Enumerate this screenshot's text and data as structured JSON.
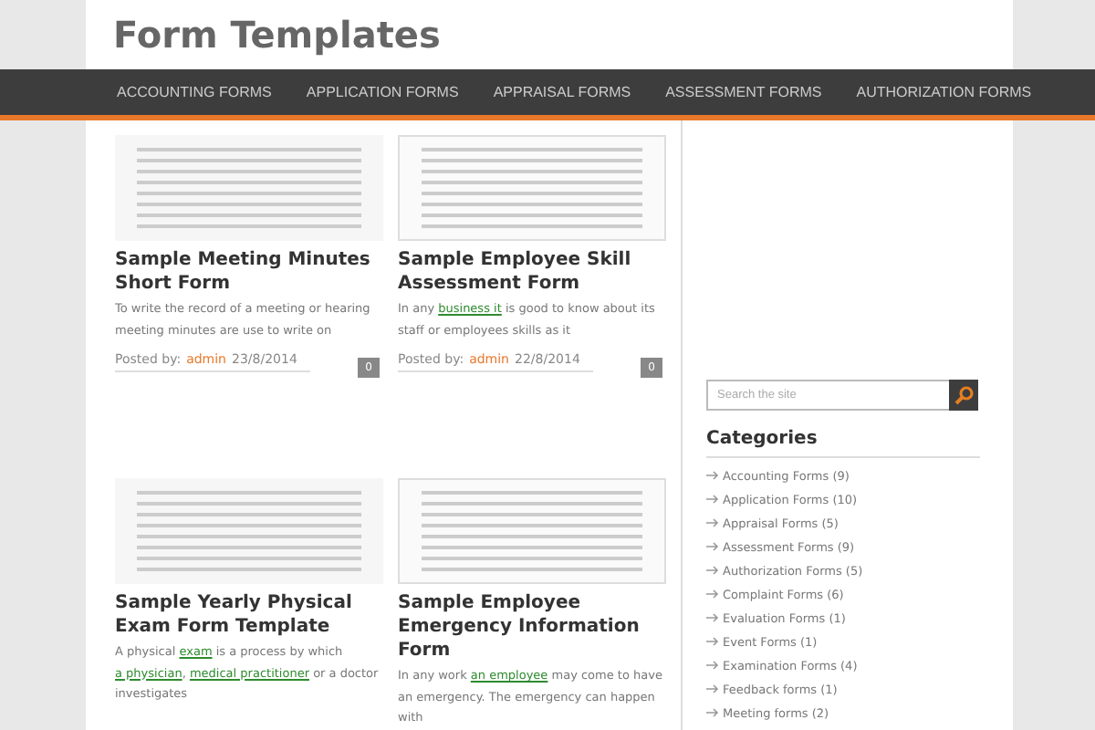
{
  "site": {
    "title": "Form Templates"
  },
  "nav": [
    {
      "label": "ACCOUNTING FORMS"
    },
    {
      "label": "APPLICATION FORMS"
    },
    {
      "label": "APPRAISAL FORMS"
    },
    {
      "label": "ASSESSMENT FORMS"
    },
    {
      "label": "AUTHORIZATION FORMS"
    }
  ],
  "posts": [
    {
      "title": "Sample Meeting Minutes Short Form",
      "excerpt": [
        {
          "kind": "text",
          "text": "To write the record of a meeting or hearing meeting minutes are use to write on"
        }
      ],
      "meta_label": "Posted by:",
      "author": "admin",
      "date": "23/8/2014",
      "comments": "0"
    },
    {
      "title": "Sample Employee Skill Assessment Form",
      "excerpt": [
        {
          "kind": "text",
          "text": "In any "
        },
        {
          "kind": "link",
          "text": "business it"
        },
        {
          "kind": "text",
          "text": " is good to know about its staff or employees skills as it"
        }
      ],
      "meta_label": "Posted by:",
      "author": "admin",
      "date": "22/8/2014",
      "comments": "0"
    },
    {
      "title": "Sample Yearly Physical Exam Form Template",
      "excerpt": [
        {
          "kind": "text",
          "text": "A physical "
        },
        {
          "kind": "link",
          "text": "exam"
        },
        {
          "kind": "text",
          "text": " is a process by which "
        },
        {
          "kind": "link",
          "text": "a physician"
        },
        {
          "kind": "text",
          "text": ", "
        },
        {
          "kind": "link",
          "text": "medical practitioner"
        },
        {
          "kind": "text",
          "text": " or a doctor investigates"
        }
      ]
    },
    {
      "title": "Sample Employee Emergency Information Form",
      "excerpt": [
        {
          "kind": "text",
          "text": "In any work "
        },
        {
          "kind": "link",
          "text": "an employee"
        },
        {
          "kind": "text",
          "text": " may come to have an emergency. The emergency can happen with"
        }
      ]
    }
  ],
  "sidebar": {
    "search": {
      "placeholder": "Search the site"
    },
    "heading": "Categories",
    "categories": [
      {
        "label": "Accounting Forms (9)"
      },
      {
        "label": "Application Forms (10)"
      },
      {
        "label": "Appraisal Forms (5)"
      },
      {
        "label": "Assessment Forms (9)"
      },
      {
        "label": "Authorization Forms (5)"
      },
      {
        "label": "Complaint Forms (6)"
      },
      {
        "label": "Evaluation Forms (1)"
      },
      {
        "label": "Event Forms (1)"
      },
      {
        "label": "Examination Forms (4)"
      },
      {
        "label": "Feedback forms (1)"
      },
      {
        "label": "Meeting forms (2)"
      }
    ]
  }
}
